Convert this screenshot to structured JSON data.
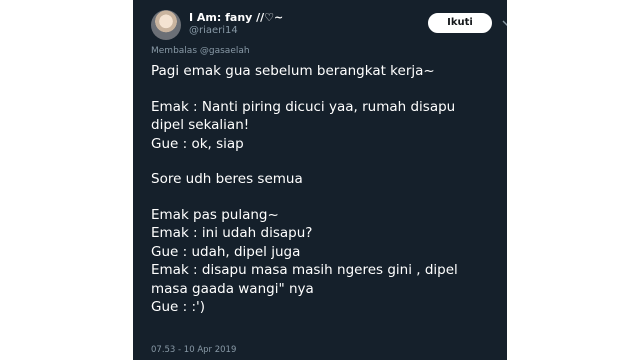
{
  "tweet": {
    "display_name": "I Am: fany //♡~",
    "handle": "@riaeri14",
    "follow_label": "Ikuti",
    "menu_icon": "chevron-down-icon",
    "reply_prefix": "Membalas",
    "reply_mention": "@gasaelah",
    "timestamp": "07.53 - 10 Apr 2019",
    "paragraphs": [
      [
        "Pagi emak gua sebelum berangkat kerja~"
      ],
      [
        "Emak : Nanti piring dicuci yaa, rumah disapu",
        "dipel sekalian!",
        "Gue : ok, siap"
      ],
      [
        "Sore udh beres semua"
      ],
      [
        "Emak pas pulang~",
        "Emak : ini udah disapu?",
        "Gue : udah, dipel juga",
        "Emak : disapu masa masih ngeres gini , dipel",
        "masa gaada wangi\" nya",
        "Gue : :')"
      ]
    ]
  },
  "colors": {
    "card_background": "#15202b",
    "text_primary": "#ffffff",
    "text_secondary": "#8899a6",
    "page_background": "#ffffff"
  }
}
